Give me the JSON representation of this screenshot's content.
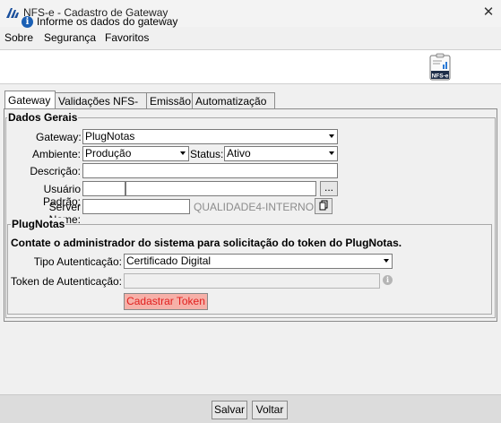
{
  "window": {
    "title": "NFS-e - Cadastro de Gateway",
    "close_glyph": "✕"
  },
  "menu": {
    "items": [
      "Sobre",
      "Segurança",
      "Favoritos"
    ]
  },
  "info": {
    "text": "Informe os dados do gateway",
    "icon": "info-icon",
    "badge_text": "NFS-e"
  },
  "tabs": [
    "Gateway",
    "Validações NFS-e",
    "Emissão",
    "Automatização"
  ],
  "dados_gerais": {
    "legend": "Dados Gerais",
    "gateway_label": "Gateway:",
    "gateway_value": "PlugNotas",
    "ambiente_label": "Ambiente:",
    "ambiente_value": "Produção",
    "status_label": "Status:",
    "status_value": "Ativo",
    "descricao_label": "Descrição:",
    "descricao_value": "",
    "usuario_label": "Usuário Padrão:",
    "usuario_code": "",
    "usuario_name": "",
    "lookup_button": "...",
    "server_label": "Server Name:",
    "server_value": "",
    "server_hint": "QUALIDADE4-INTERNO"
  },
  "plugnotas": {
    "legend": "PlugNotas",
    "notice": "Contate o administrador do sistema para solicitação do token do PlugNotas.",
    "tipo_label": "Tipo Autenticação:",
    "tipo_value": "Certificado Digital",
    "token_label": "Token de Autenticação:",
    "token_value": "",
    "cadastrar_button": "Cadastrar Token"
  },
  "footer": {
    "save_button": "Salvar",
    "back_button": "Voltar"
  },
  "colors": {
    "accent_info": "#1a5fb4",
    "cadastrar_text": "#e0201e",
    "cadastrar_bg": "#f6b0a8"
  }
}
